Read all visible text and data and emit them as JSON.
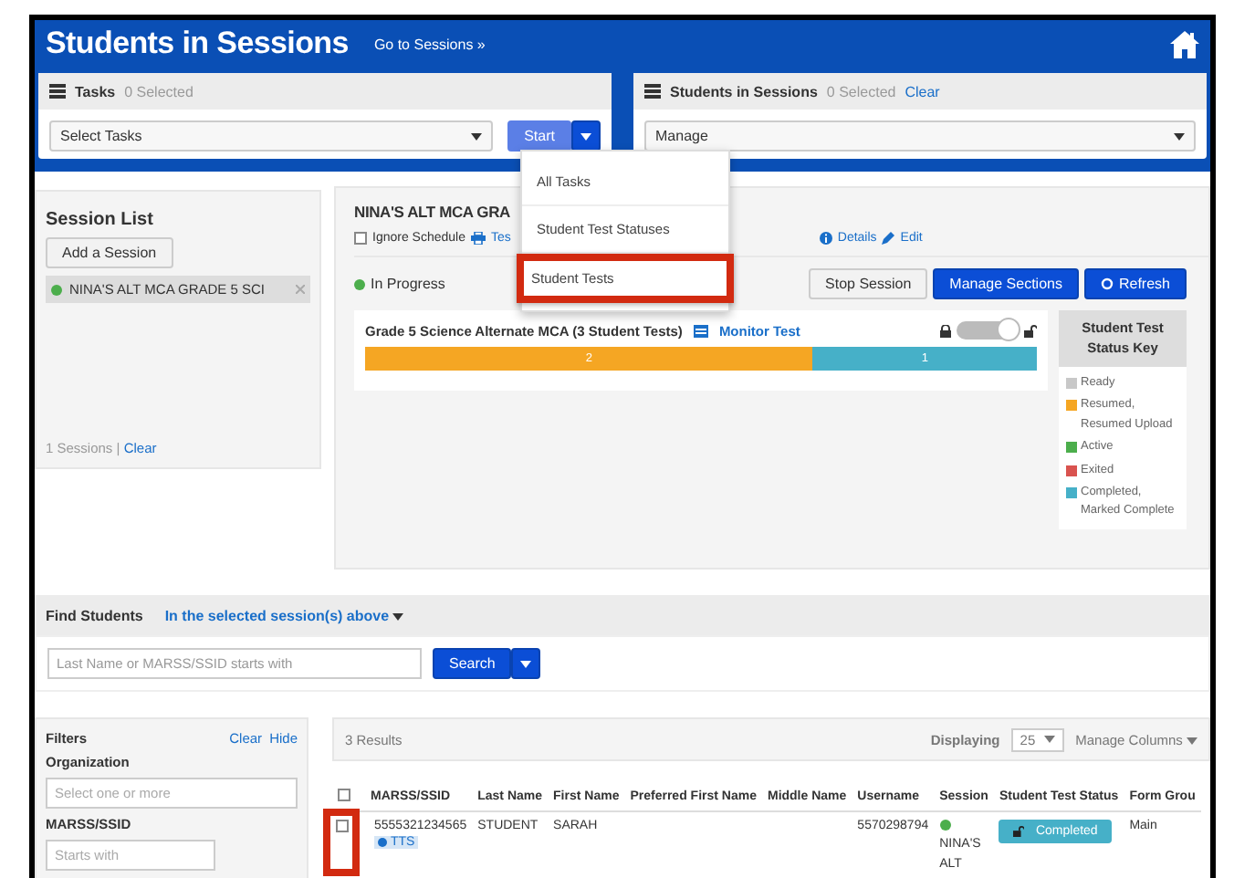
{
  "header": {
    "title": "Students in Sessions",
    "link": "Go to Sessions »"
  },
  "tasks_panel": {
    "title": "Tasks",
    "count": "0 Selected",
    "select": "Select Tasks",
    "start_button": "Start"
  },
  "students_panel": {
    "title": "Students in Sessions",
    "count": "0 Selected",
    "clear": "Clear",
    "select": "Manage"
  },
  "tasks_menu": {
    "items": [
      {
        "label": "All Tasks",
        "highlighted": false
      },
      {
        "label": "Student Test Statuses",
        "highlighted": false
      },
      {
        "label": "Student Tests",
        "highlighted": true
      }
    ]
  },
  "session_list": {
    "title": "Session List",
    "add_button": "Add a Session",
    "items": [
      {
        "name": "NINA'S ALT MCA GRADE 5 SCI",
        "color": "#4cae4c",
        "selected": true
      }
    ],
    "count": "1 Sessions",
    "separator": "|",
    "clear": "Clear"
  },
  "session": {
    "title": "NINA'S ALT MCA GRA",
    "ignore_schedule": {
      "label": "Ignore Schedule",
      "checked": false
    },
    "tickets_link": "Tes",
    "details_link": "Details",
    "edit_link": "Edit",
    "status": "In Progress",
    "buttons": [
      {
        "label": "Stop Session",
        "kind": "default"
      },
      {
        "label": "Manage Sections",
        "kind": "primary"
      },
      {
        "label": "Refresh",
        "kind": "refresh"
      }
    ],
    "test": {
      "title": "Grade 5 Science Alternate MCA (3 Student Tests)",
      "monitor_link": "Monitor Test",
      "unlocked": true,
      "progress": {
        "level": 0.667,
        "in_progress_count": "2",
        "completed_count": "1"
      }
    },
    "status_key": {
      "title": "Student Test Status Key",
      "items": [
        {
          "label": "Ready",
          "color": "#c8c8c8"
        },
        {
          "label": "Resumed, Resumed Upload",
          "color": "#f5a623"
        },
        {
          "label": "Active",
          "color": "#4cae4c"
        },
        {
          "label": "Exited",
          "color": "#d9534f"
        },
        {
          "label": "Completed, Marked Complete",
          "color": "#46b0c8"
        }
      ]
    }
  },
  "find_students": {
    "title": "Find Students",
    "scope": "In the selected session(s) above",
    "placeholder": "Last Name or MARSS/SSID starts with",
    "search_button": "Search"
  },
  "filters": {
    "title": "Filters",
    "clear": "Clear",
    "hide": "Hide",
    "organization": {
      "label": "Organization",
      "placeholder": "Select one or more"
    },
    "marss": {
      "label": "MARSS/SSID",
      "placeholder": "Starts with"
    }
  },
  "results": {
    "count": "3 Results",
    "displaying_label": "Displaying",
    "page_size": "25",
    "manage_columns": "Manage Columns",
    "columns": [
      "MARSS/SSID",
      "Last Name",
      "First Name",
      "Preferred First Name",
      "Middle Name",
      "Username",
      "Session",
      "Student Test Status",
      "Form Grou"
    ],
    "all_checked": false,
    "rows": [
      {
        "checked": false,
        "highlighted": true,
        "marss": "5555321234565",
        "accommodation": "TTS",
        "last_name": "STUDENT",
        "first_name": "SARAH",
        "username": "5570298794",
        "session": "NINA'S ALT",
        "status": "Completed",
        "form_group": "Main"
      }
    ]
  }
}
